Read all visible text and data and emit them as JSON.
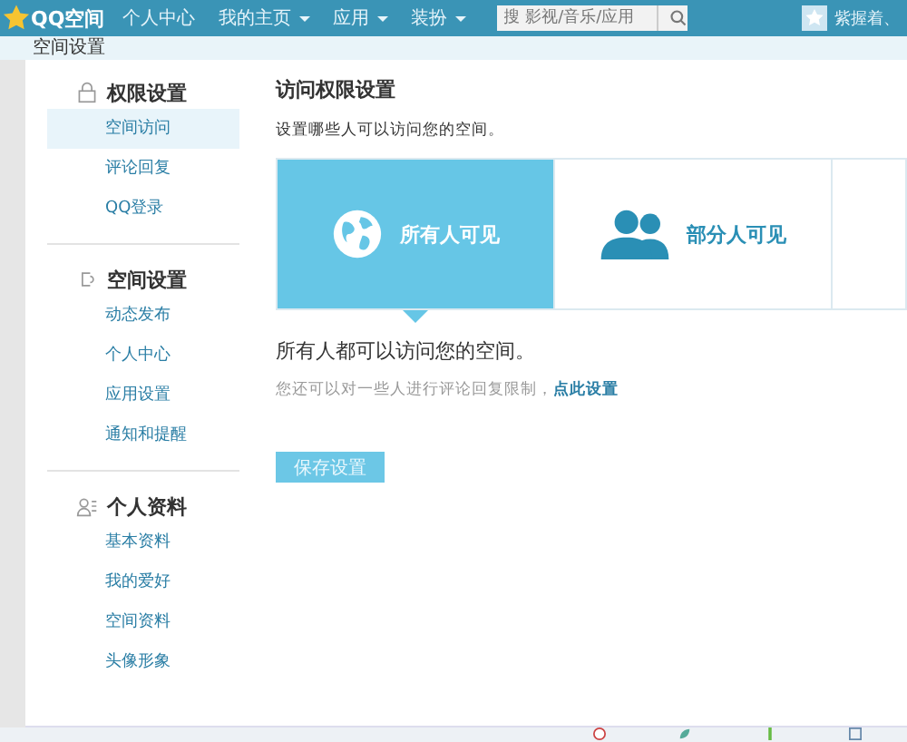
{
  "topbar": {
    "logo": "QQ空间",
    "nav": [
      {
        "label": "个人中心",
        "dropdown": false
      },
      {
        "label": "我的主页",
        "dropdown": true
      },
      {
        "label": "应用",
        "dropdown": true
      },
      {
        "label": "装扮",
        "dropdown": true
      }
    ],
    "search": {
      "placeholder": "搜 影视/音乐/应用"
    },
    "user": "紫握着、"
  },
  "page_title": "空间设置",
  "sidebar": [
    {
      "kind": "lock",
      "title": "权限设置",
      "items": [
        {
          "label": "空间访问",
          "selected": true
        },
        {
          "label": "评论回复",
          "selected": false
        },
        {
          "label": "QQ登录",
          "selected": false
        }
      ]
    },
    {
      "kind": "gear",
      "title": "空间设置",
      "items": [
        {
          "label": "动态发布",
          "selected": false
        },
        {
          "label": "个人中心",
          "selected": false
        },
        {
          "label": "应用设置",
          "selected": false
        },
        {
          "label": "通知和提醒",
          "selected": false
        }
      ]
    },
    {
      "kind": "person",
      "title": "个人资料",
      "items": [
        {
          "label": "基本资料",
          "selected": false
        },
        {
          "label": "我的爱好",
          "selected": false
        },
        {
          "label": "空间资料",
          "selected": false
        },
        {
          "label": "头像形象",
          "selected": false
        }
      ]
    }
  ],
  "content": {
    "title": "访问权限设置",
    "subtitle": "设置哪些人可以访问您的空间。",
    "options": [
      {
        "kind": "globe",
        "label": "所有人可见",
        "selected": true
      },
      {
        "kind": "people",
        "label": "部分人可见",
        "selected": false
      }
    ],
    "description": "所有人都可以访问您的空间。",
    "note": "您还可以对一些人进行评论回复限制，",
    "note_link": "点此设置",
    "save": "保存设置"
  }
}
